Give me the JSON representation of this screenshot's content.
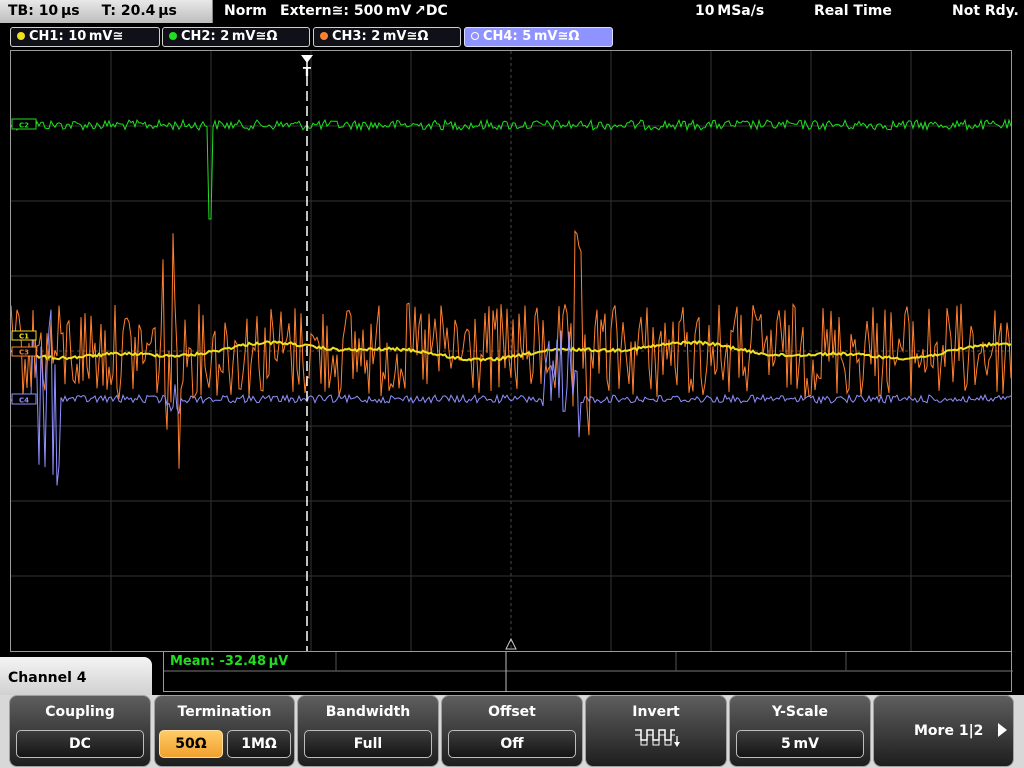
{
  "status": {
    "timebase": "TB: 10 µs",
    "trigger_time": "T: 20.4 µs",
    "mode": "Norm",
    "trigger_source": "Extern≅: 500 mV ↗DC",
    "sample_rate": "10 MSa/s",
    "acq_mode": "Real Time",
    "ready": "Not Rdy."
  },
  "channels": [
    {
      "label": "CH1: 10 mV≅",
      "color": "#f0e020",
      "marker": "C1"
    },
    {
      "label": "CH2: 2 mV≅Ω",
      "color": "#20e020",
      "marker": "C2"
    },
    {
      "label": "CH3: 2 mV≅Ω",
      "color": "#ff8030",
      "marker": "C3"
    },
    {
      "label": "CH4: 5 mV≅Ω",
      "color": "#9090ff",
      "marker": "C4"
    }
  ],
  "trigger_marker": "T",
  "measurement": {
    "mean": "Mean: -32.48 µV"
  },
  "menu": {
    "title": "Channel 4",
    "coupling": {
      "title": "Coupling",
      "value": "DC"
    },
    "termination": {
      "title": "Termination",
      "options": [
        "50Ω",
        "1MΩ"
      ],
      "selected": "50Ω"
    },
    "bandwidth": {
      "title": "Bandwidth",
      "value": "Full"
    },
    "offset": {
      "title": "Offset",
      "value": "Off"
    },
    "invert": {
      "title": "Invert",
      "icon": "invert-waveform-icon"
    },
    "yscale": {
      "title": "Y-Scale",
      "value": "5 mV"
    },
    "more": {
      "label": "More 1|2"
    }
  }
}
